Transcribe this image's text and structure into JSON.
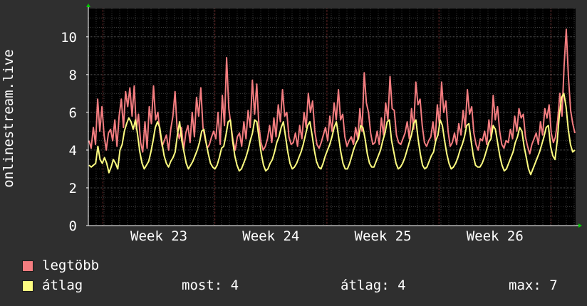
{
  "chart_data": {
    "type": "line",
    "ylabel": "onlinestream.live",
    "ylim": [
      0,
      11.5
    ],
    "yticks": [
      0,
      2,
      4,
      6,
      8,
      10
    ],
    "x_tick_labels": [
      "Week 23",
      "Week 24",
      "Week 25",
      "Week 26"
    ],
    "grid": true,
    "colors": {
      "background": "#2f2f2f",
      "plot_background": "#000000",
      "grid_minor": "#3a3a3a",
      "grid_major_v": "#7a2e2e",
      "axis": "#ffffff",
      "arrow": "#00cc00",
      "legtobb": "#f47d80",
      "atlag": "#fefd80"
    },
    "series": [
      {
        "name": "legtöbb",
        "color": "#f47d80",
        "values": [
          4.5,
          4.1,
          5.2,
          4.3,
          6.7,
          5.0,
          6.3,
          4.8,
          4.0,
          4.9,
          5.1,
          4.5,
          5.6,
          4.2,
          5.8,
          6.7,
          5.2,
          7.1,
          6.3,
          7.3,
          5.8,
          7.4,
          5.1,
          5.9,
          4.4,
          3.9,
          5.5,
          4.1,
          6.3,
          5.4,
          7.4,
          5.6,
          6.0,
          4.9,
          4.2,
          4.5,
          4.8,
          4.0,
          5.1,
          5.8,
          7.1,
          5.1,
          4.6,
          5.2,
          4.0,
          4.9,
          5.3,
          4.4,
          6.0,
          4.7,
          6.8,
          5.8,
          7.3,
          5.2,
          4.6,
          4.1,
          4.3,
          4.7,
          5.0,
          4.6,
          6.0,
          4.3,
          6.9,
          5.3,
          8.9,
          6.2,
          5.3,
          4.5,
          4.0,
          4.7,
          4.9,
          4.2,
          5.5,
          4.6,
          6.1,
          5.2,
          7.7,
          5.9,
          7.5,
          5.3,
          4.4,
          4.0,
          4.2,
          4.6,
          5.3,
          4.4,
          5.7,
          4.7,
          6.4,
          5.5,
          7.2,
          5.8,
          6.0,
          4.7,
          4.3,
          4.4,
          4.9,
          4.2,
          5.3,
          4.6,
          6.0,
          5.2,
          7.0,
          6.0,
          6.6,
          5.0,
          4.3,
          4.1,
          4.4,
          4.8,
          5.2,
          4.5,
          5.8,
          5.0,
          6.5,
          5.6,
          7.2,
          5.6,
          5.9,
          4.7,
          4.2,
          4.5,
          4.7,
          4.3,
          5.2,
          4.6,
          6.2,
          5.0,
          8.1,
          6.5,
          6.0,
          4.9,
          4.3,
          4.4,
          5.0,
          4.3,
          5.7,
          4.8,
          6.5,
          5.6,
          7.9,
          6.2,
          6.1,
          4.8,
          4.4,
          4.3,
          4.6,
          4.9,
          5.5,
          4.6,
          6.2,
          5.1,
          7.6,
          6.4,
          6.7,
          5.3,
          4.4,
          4.2,
          4.5,
          4.7,
          5.5,
          4.5,
          6.4,
          5.3,
          7.6,
          6.0,
          6.6,
          5.0,
          4.2,
          4.4,
          4.9,
          4.3,
          5.4,
          4.8,
          6.1,
          5.2,
          7.2,
          5.9,
          6.3,
          4.9,
          4.3,
          4.0,
          4.6,
          4.5,
          5.0,
          4.3,
          5.6,
          4.7,
          6.9,
          5.6,
          6.3,
          5.0,
          4.3,
          4.1,
          4.5,
          4.4,
          5.1,
          4.6,
          5.8,
          5.0,
          6.2,
          5.7,
          5.9,
          4.7,
          4.2,
          3.8,
          4.3,
          4.6,
          4.9,
          4.3,
          5.5,
          4.8,
          6.2,
          5.7,
          6.4,
          4.9,
          4.4,
          4.7,
          5.6,
          7.0,
          5.8,
          8.5,
          10.4,
          7.9,
          6.1,
          5.4,
          4.9
        ]
      },
      {
        "name": "átlag",
        "color": "#fefd80",
        "values": [
          3.2,
          3.1,
          3.2,
          3.3,
          4.2,
          3.5,
          3.3,
          3.6,
          3.3,
          2.8,
          3.1,
          3.5,
          3.3,
          3.0,
          4.0,
          4.3,
          5.0,
          5.4,
          5.7,
          5.5,
          5.1,
          5.6,
          4.8,
          3.9,
          3.3,
          3.0,
          3.2,
          3.4,
          3.9,
          4.5,
          5.2,
          5.5,
          5.2,
          4.4,
          3.7,
          3.3,
          3.1,
          3.4,
          3.6,
          3.9,
          4.8,
          5.5,
          4.5,
          3.9,
          3.3,
          3.0,
          3.2,
          3.4,
          3.7,
          4.0,
          4.4,
          5.0,
          5.1,
          4.4,
          3.8,
          3.3,
          3.1,
          3.0,
          3.2,
          3.6,
          4.1,
          4.2,
          4.8,
          5.5,
          5.6,
          4.5,
          3.7,
          3.2,
          2.9,
          3.0,
          3.3,
          3.6,
          4.0,
          4.5,
          4.9,
          5.6,
          5.5,
          4.6,
          3.8,
          3.2,
          2.9,
          3.0,
          3.3,
          3.5,
          3.9,
          4.4,
          4.7,
          5.2,
          5.5,
          4.7,
          3.9,
          3.3,
          3.0,
          3.1,
          3.3,
          3.6,
          3.9,
          4.3,
          4.8,
          5.3,
          5.5,
          4.8,
          4.0,
          3.4,
          3.1,
          3.0,
          3.3,
          3.7,
          4.0,
          4.3,
          4.7,
          5.2,
          5.5,
          4.7,
          3.9,
          3.3,
          3.0,
          3.0,
          3.3,
          3.7,
          4.1,
          4.4,
          4.6,
          5.3,
          5.2,
          4.6,
          3.8,
          3.3,
          3.1,
          3.1,
          3.4,
          3.7,
          4.0,
          4.5,
          4.9,
          5.5,
          5.6,
          4.5,
          3.9,
          3.3,
          3.0,
          3.1,
          3.3,
          3.6,
          4.0,
          4.4,
          4.8,
          5.4,
          5.6,
          4.6,
          3.8,
          3.2,
          3.0,
          3.1,
          3.4,
          3.7,
          3.9,
          4.5,
          4.8,
          5.6,
          5.3,
          4.5,
          3.8,
          3.3,
          3.0,
          3.1,
          3.3,
          3.6,
          4.0,
          4.3,
          4.7,
          5.3,
          5.4,
          4.5,
          3.7,
          3.2,
          3.1,
          3.1,
          3.3,
          3.6,
          4.0,
          4.4,
          4.6,
          5.3,
          5.1,
          4.4,
          3.7,
          3.2,
          2.9,
          3.0,
          3.3,
          3.6,
          3.9,
          4.4,
          4.7,
          5.2,
          5.0,
          4.2,
          3.6,
          3.0,
          2.7,
          3.0,
          3.3,
          3.6,
          3.9,
          4.3,
          4.7,
          5.2,
          5.3,
          4.2,
          3.7,
          3.5,
          4.5,
          5.9,
          6.8,
          7.0,
          6.3,
          5.1,
          4.3,
          3.9,
          4.0
        ]
      }
    ]
  },
  "legend": [
    {
      "label": "legtöbb",
      "color": "#f47d80"
    },
    {
      "label": "átlag",
      "color": "#fefd80"
    }
  ],
  "stats": {
    "most": "most: 4",
    "atlag": "átlag: 4",
    "max": "max: 7"
  }
}
